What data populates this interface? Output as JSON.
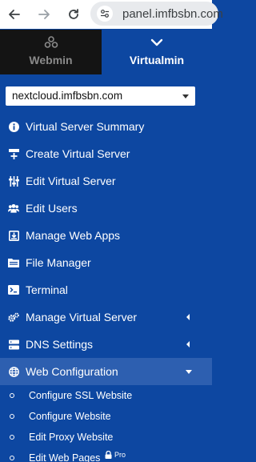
{
  "browser": {
    "url": "panel.imfbsbn.com"
  },
  "switcher": {
    "webmin_label": "Webmin",
    "virtualmin_label": "Virtualmin",
    "active": "Virtualmin"
  },
  "domain_select": {
    "value": "nextcloud.imfbsbn.com"
  },
  "menu": {
    "items": [
      {
        "label": "Virtual Server Summary",
        "icon": "info-circle-icon"
      },
      {
        "label": "Create Virtual Server",
        "icon": "create-server-icon"
      },
      {
        "label": "Edit Virtual Server",
        "icon": "sliders-icon"
      },
      {
        "label": "Edit Users",
        "icon": "users-icon"
      },
      {
        "label": "Manage Web Apps",
        "icon": "download-box-icon"
      },
      {
        "label": "File Manager",
        "icon": "folder-icon"
      },
      {
        "label": "Terminal",
        "icon": "terminal-icon"
      },
      {
        "label": "Manage Virtual Server",
        "icon": "cogs-icon",
        "expandable": true
      },
      {
        "label": "DNS Settings",
        "icon": "server-icon",
        "expandable": true
      },
      {
        "label": "Web Configuration",
        "icon": "globe-icon",
        "expanded": true
      }
    ],
    "submenu": [
      {
        "label": "Configure SSL Website"
      },
      {
        "label": "Configure Website"
      },
      {
        "label": "Edit Proxy Website"
      },
      {
        "label": "Edit Web Pages",
        "badge": "Pro",
        "badge_icon": "lock-icon"
      }
    ]
  },
  "colors": {
    "sidebar_bg": "#0d47a1",
    "active_item_bg": "#2d5fb0",
    "webmin_tab_bg": "#141414"
  }
}
